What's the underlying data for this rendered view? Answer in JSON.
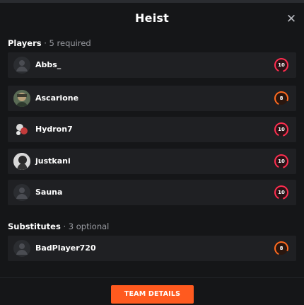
{
  "dialog": {
    "title": "Heist",
    "close_icon": "close-icon"
  },
  "players": {
    "label": "Players",
    "sub": " · 5 required",
    "items": [
      {
        "name": "Abbs_",
        "badge": "10",
        "badge_color": "#ff2d4f",
        "avatar": "default-avatar"
      },
      {
        "name": "Ascarione",
        "badge": "8",
        "badge_color": "#ff6a1f",
        "avatar": "user-avatar"
      },
      {
        "name": "Hydron7",
        "badge": "10",
        "badge_color": "#ff2d4f",
        "avatar": "user-avatar"
      },
      {
        "name": "justkani",
        "badge": "10",
        "badge_color": "#ff2d4f",
        "avatar": "user-avatar"
      },
      {
        "name": "Sauna",
        "badge": "10",
        "badge_color": "#ff2d4f",
        "avatar": "default-avatar"
      }
    ]
  },
  "substitutes": {
    "label": "Substitutes",
    "sub": " · 3 optional",
    "items": [
      {
        "name": "BadPlayer720",
        "badge": "8",
        "badge_color": "#ff6a1f",
        "avatar": "default-avatar"
      }
    ]
  },
  "footer": {
    "button_label": "TEAM DETAILS"
  },
  "colors": {
    "accent": "#ff5a1f",
    "background": "#151618",
    "row": "#1f2023"
  }
}
